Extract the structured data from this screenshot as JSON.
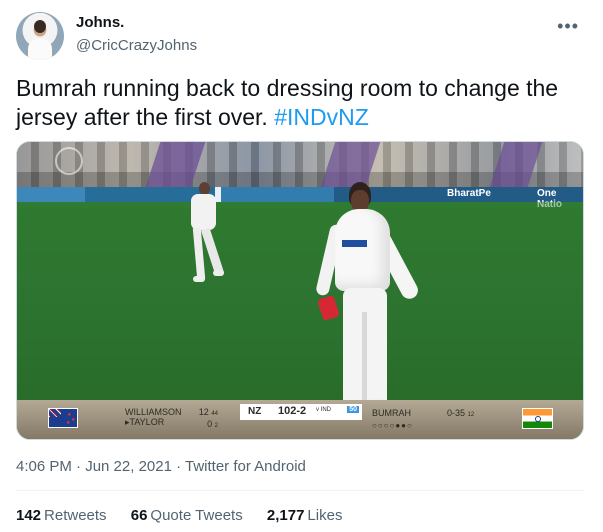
{
  "tweet": {
    "display_name": "Johns.",
    "handle": "@CricCrazyJohns",
    "text_main": "Bumrah running back to dressing room to change the jersey after the first over.",
    "hashtag": "#INDvNZ",
    "timestamp": "4:06 PM · Jun 22, 2021 · Twitter for Android"
  },
  "icons": {
    "more": "more-options-icon"
  },
  "media": {
    "ad_boards": [
      "BharatPe",
      "One Natio"
    ],
    "scoreboard": {
      "batter_1": "WILLIAMSON",
      "batter_1_score": "12",
      "batter_1_balls": "44",
      "batter_2": "▸TAYLOR",
      "batter_2_score": "0",
      "batter_2_balls": "2",
      "team": "NZ",
      "total": "102-2",
      "vs": "v IND",
      "over": "50",
      "bowler": "BUMRAH",
      "bowler_figures": "0-35",
      "bowler_overs": "12",
      "balls": "○○○○●●○"
    },
    "colors": {
      "field": "#2f7d2e",
      "india_flag_orange": "#ff9933",
      "india_flag_green": "#138808",
      "nz_flag_blue": "#1b3d8f"
    }
  },
  "metrics": [
    {
      "value": "142",
      "label": "Retweets"
    },
    {
      "value": "66",
      "label": "Quote Tweets"
    },
    {
      "value": "2,177",
      "label": "Likes"
    }
  ]
}
